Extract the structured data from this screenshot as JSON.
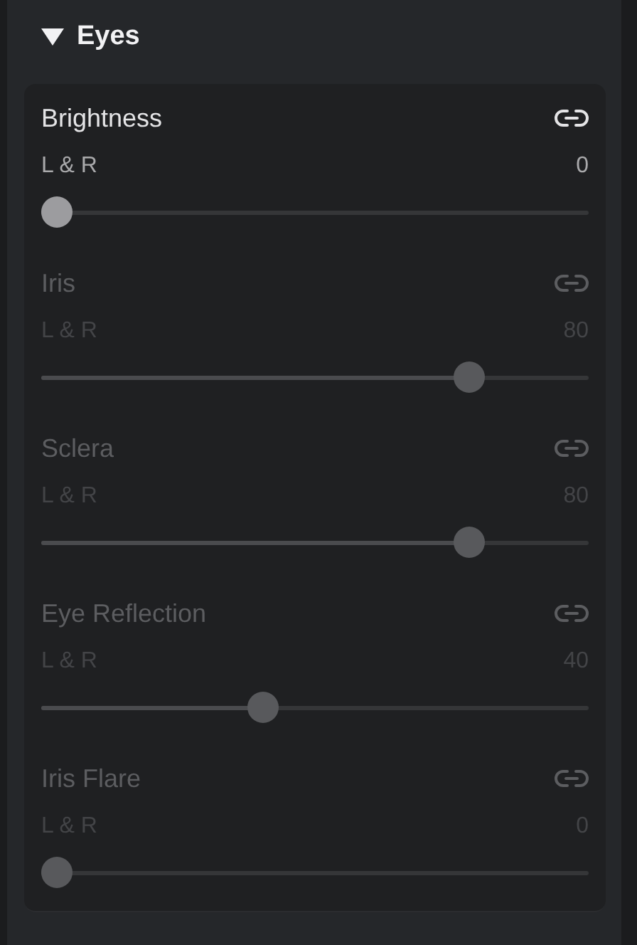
{
  "section": {
    "title": "Eyes",
    "expanded": true
  },
  "sliders": [
    {
      "label": "Brightness",
      "sublabel": "L & R",
      "value": "0",
      "level": 0,
      "disabled": false
    },
    {
      "label": "Iris",
      "sublabel": "L & R",
      "value": "80",
      "level": 0.8,
      "disabled": true
    },
    {
      "label": "Sclera",
      "sublabel": "L & R",
      "value": "80",
      "level": 0.8,
      "disabled": true
    },
    {
      "label": "Eye Reflection",
      "sublabel": "L & R",
      "value": "40",
      "level": 0.4,
      "disabled": true
    },
    {
      "label": "Iris Flare",
      "sublabel": "L & R",
      "value": "0",
      "level": 0,
      "disabled": true
    }
  ]
}
